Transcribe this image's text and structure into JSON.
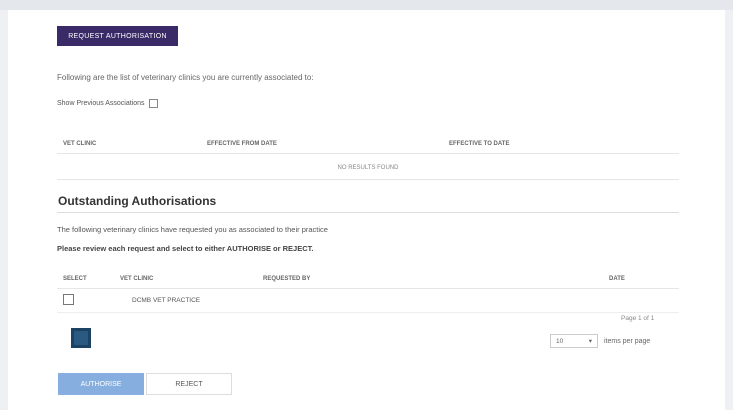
{
  "toolbar": {
    "request_label": "Request Authorisation"
  },
  "associated": {
    "intro": "Following are the list of veterinary clinics you are currently associated to:",
    "show_previous_label": "Show Previous Associations",
    "columns": [
      "Vet Clinic",
      "Effective From Date",
      "Effective To Date"
    ],
    "empty_message": "No results found"
  },
  "outstanding": {
    "title": "Outstanding Authorisations",
    "desc": "The following veterinary clinics have requested you as associated to their practice",
    "instructions": "Please review each request and select to either AUTHORISE or REJECT.",
    "columns": [
      "Select",
      "Vet Clinic",
      "Requested By",
      "Date"
    ],
    "rows": [
      {
        "clinic": "DCMB VET PRACTICE",
        "requested_by": "",
        "date": ""
      }
    ],
    "paging": "Page 1 of 1",
    "current_page": "1",
    "per_page_value": "10",
    "per_page_label": "items per page"
  },
  "actions": {
    "authorise": "Authorise",
    "reject": "Reject"
  },
  "colors": {
    "primary": "#3a2a68",
    "authorise": "#86aede",
    "pager": "#2a5a82"
  }
}
